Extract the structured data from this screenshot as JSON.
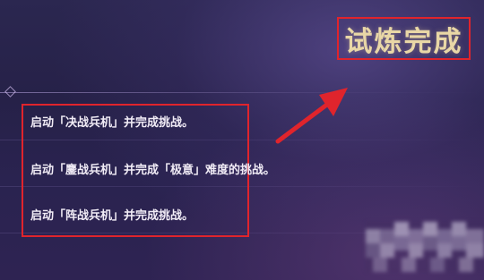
{
  "title": "试炼完成",
  "challenges": [
    {
      "text": "启动「决战兵机」并完成挑战。"
    },
    {
      "text": "启动「鏖战兵机」并完成「极意」难度的挑战。"
    },
    {
      "text": "启动「阵战兵机」并完成挑战。"
    }
  ],
  "colors": {
    "annotation_red": "#e0242c",
    "title_gold": "#e9d7a6",
    "text_white": "#f1ecf6",
    "background": "#2a2350"
  },
  "icons": {
    "arrow": "red-arrow-icon",
    "header_ornament": "diamond-ornament-icon"
  }
}
